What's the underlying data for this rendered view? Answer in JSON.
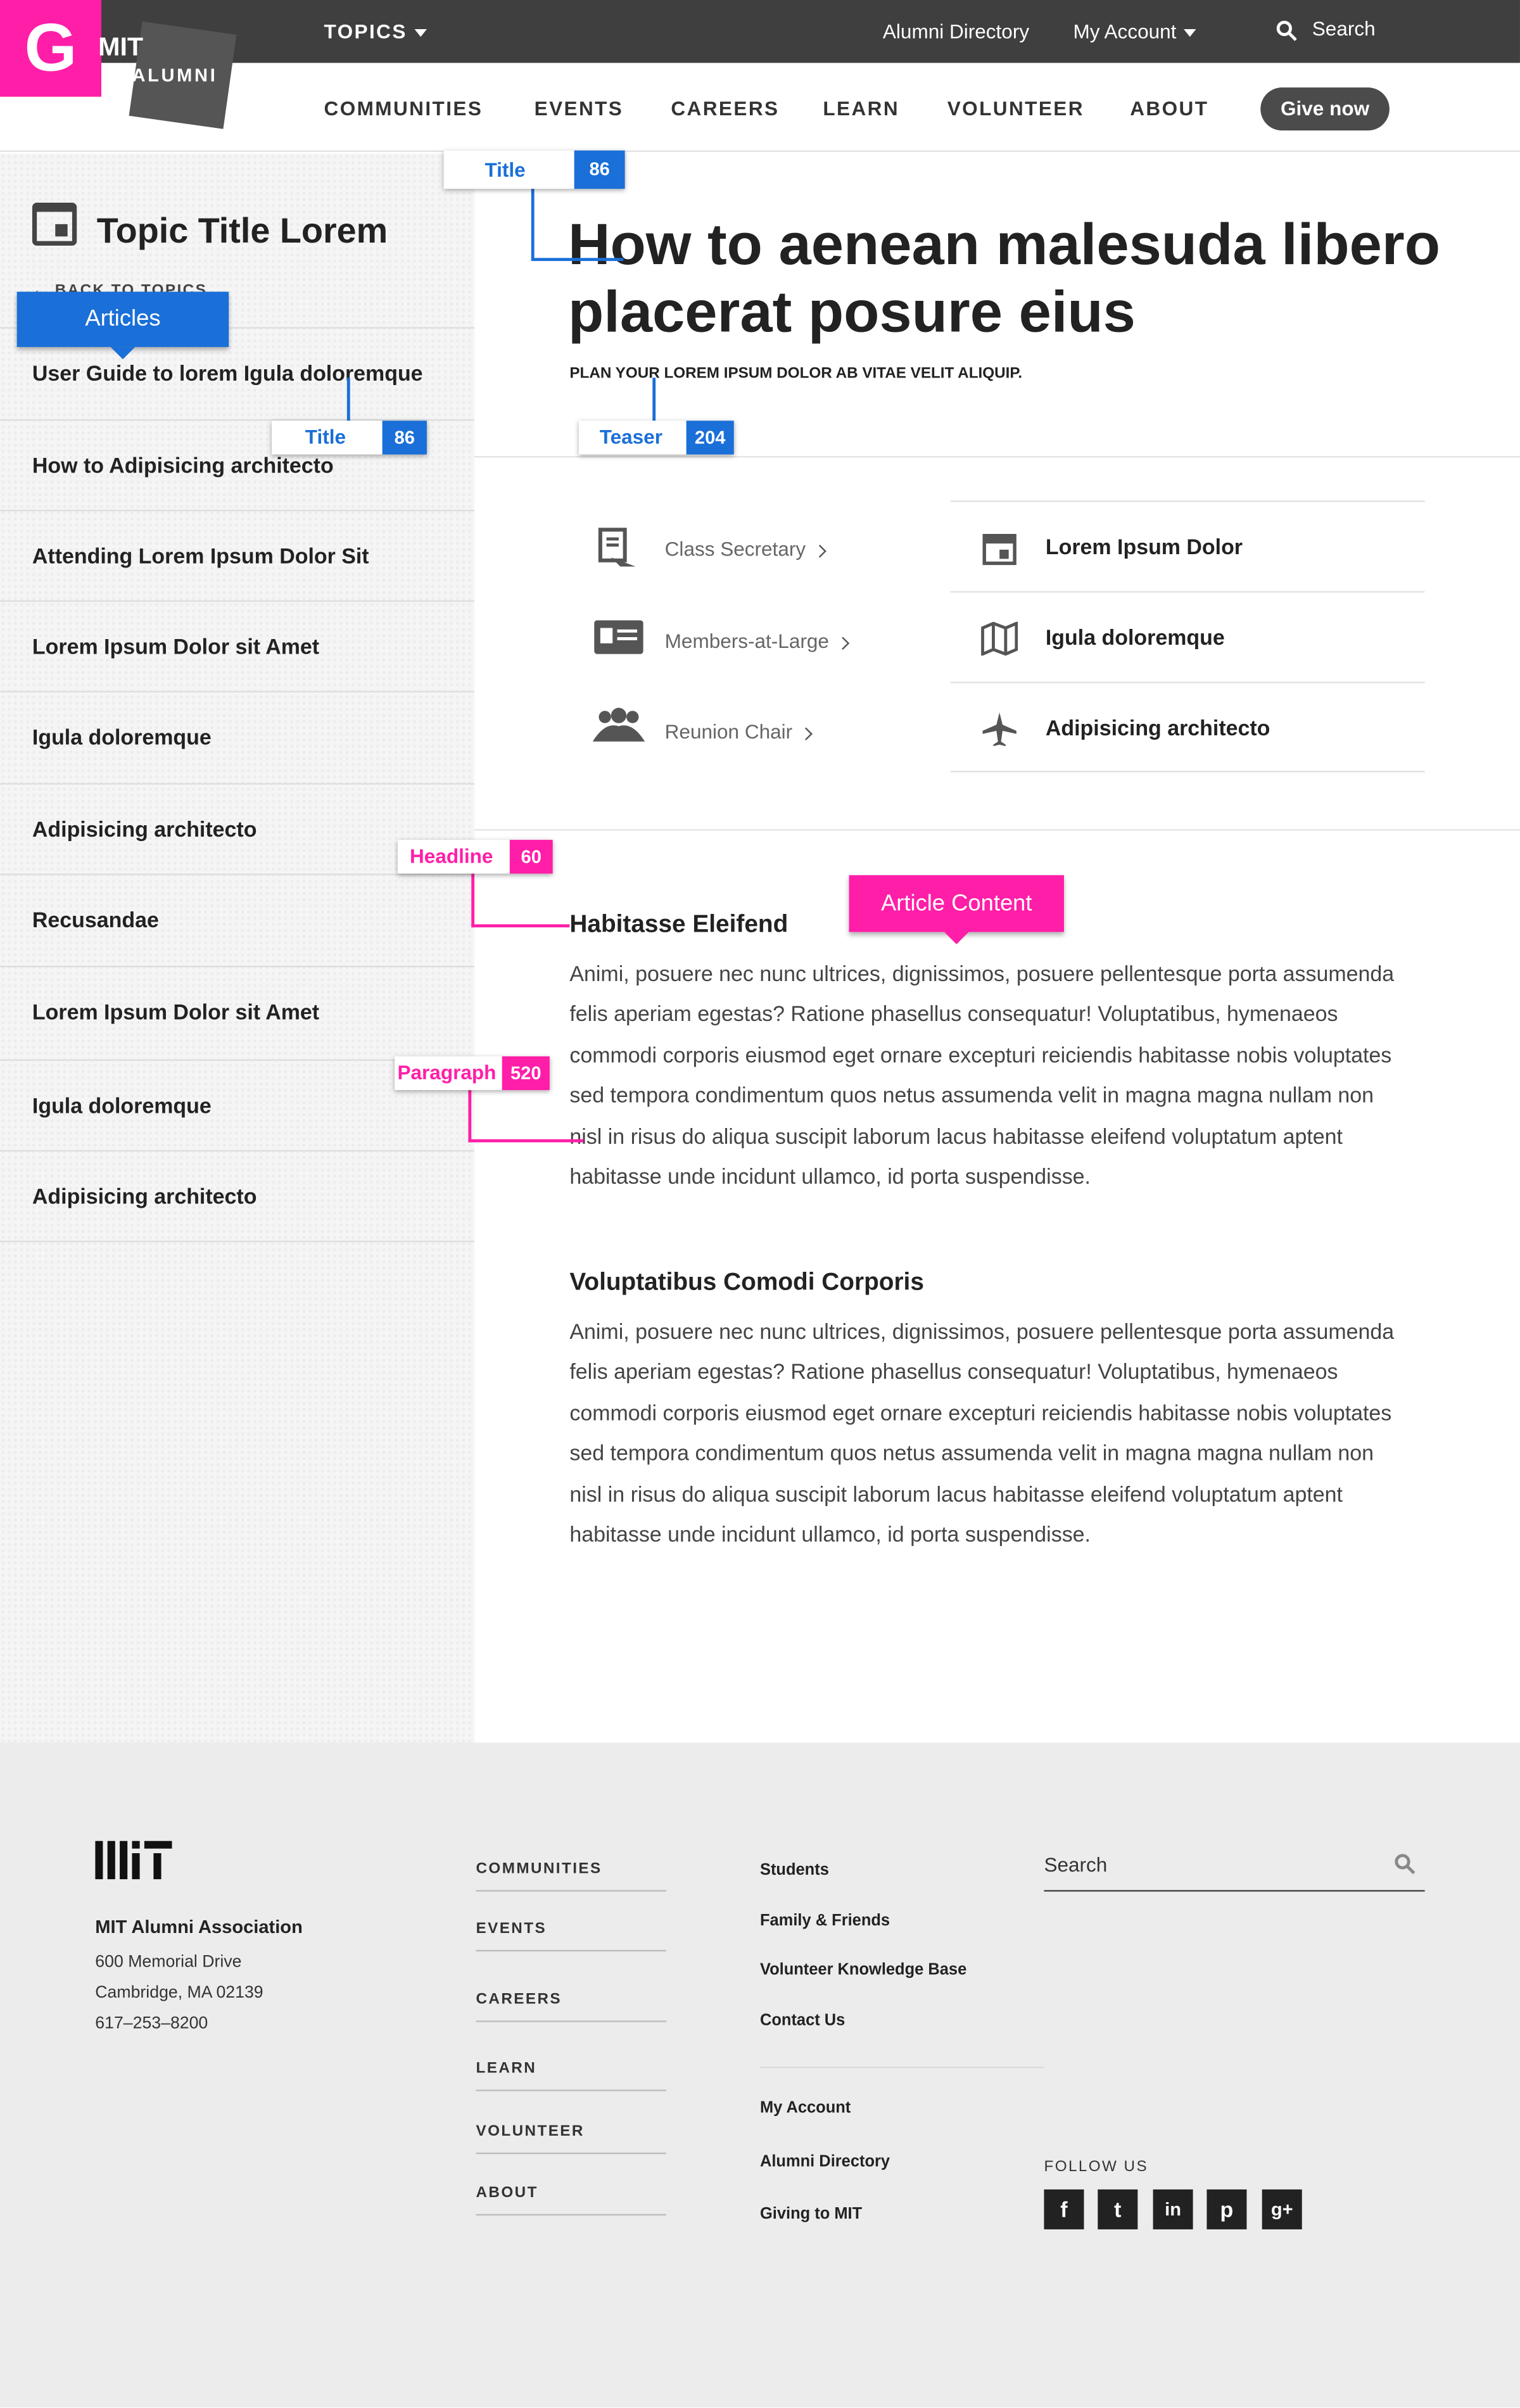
{
  "header": {
    "topics_label": "TOPICS",
    "alumni_directory": "Alumni Directory",
    "my_account": "My Account",
    "search_label": "Search",
    "badge_letter": "G",
    "logo_mit": "MIT",
    "logo_alumni": "ALUMNI",
    "nav": [
      "COMMUNITIES",
      "EVENTS",
      "CAREERS",
      "LEARN",
      "VOLUNTEER",
      "ABOUT"
    ],
    "give_now": "Give now"
  },
  "sidebar": {
    "title": "Topic Title Lorem",
    "back": "BACK TO TOPICS",
    "items": [
      "User Guide to lorem Igula doloremque",
      "How to Adipisicing architecto",
      "Attending Lorem Ipsum Dolor Sit",
      "Lorem Ipsum Dolor sit Amet",
      "Igula doloremque",
      "Adipisicing architecto",
      "Recusandae",
      "Lorem Ipsum Dolor sit Amet",
      "Igula doloremque",
      "Adipisicing architecto"
    ]
  },
  "main": {
    "title": "How to aenean malesuda libero placerat posure eius",
    "teaser": "PLAN YOUR LOREM IPSUM DOLOR AB VITAE VELIT ALIQUIP.",
    "quick_links": [
      "Class Secretary",
      "Members-at-Large",
      "Reunion Chair"
    ],
    "related_links": [
      "Lorem Ipsum Dolor",
      "Igula doloremque",
      "Adipisicing architecto"
    ],
    "sections": [
      {
        "headline": "Habitasse Eleifend",
        "paragraph": "Animi, posuere nec nunc ultrices, dignissimos, posuere pellentesque porta assumenda felis aperiam egestas? Ratione phasellus consequatur! Voluptatibus, hymenaeos commodi corporis eiusmod eget ornare excepturi reiciendis habitasse nobis voluptates sed tempora condimentum quos netus assumenda velit in magna magna nullam non nisl in risus do aliqua suscipit laborum lacus habitasse eleifend voluptatum aptent habitasse unde incidunt ullamco, id porta suspendisse."
      },
      {
        "headline": "Voluptatibus Comodi Corporis",
        "paragraph": "Animi, posuere nec nunc ultrices, dignissimos, posuere pellentesque porta assumenda felis aperiam egestas? Ratione phasellus consequatur! Voluptatibus, hymenaeos commodi corporis eiusmod eget ornare excepturi reiciendis habitasse nobis voluptates sed tempora condimentum quos netus assumenda velit in magna magna nullam non nisl in risus do aliqua suscipit laborum lacus habitasse eleifend voluptatum aptent habitasse unde incidunt ullamco, id porta suspendisse."
      }
    ]
  },
  "annotations": {
    "title_top": {
      "label": "Title",
      "num": "86"
    },
    "title_side": {
      "label": "Title",
      "num": "86"
    },
    "teaser": {
      "label": "Teaser",
      "num": "204"
    },
    "headline": {
      "label": "Headline",
      "num": "60"
    },
    "paragraph": {
      "label": "Paragraph",
      "num": "520"
    },
    "articles_callout": "Articles",
    "content_callout": "Article Content",
    "blue_color": "#1a6fd8",
    "pink_color": "#ff1ea8"
  },
  "footer": {
    "org_name": "MIT Alumni Association",
    "address1": "600 Memorial Drive",
    "address2": "Cambridge, MA 02139",
    "phone": "617–253–8200",
    "nav": [
      "COMMUNITIES",
      "EVENTS",
      "CAREERS",
      "LEARN",
      "VOLUNTEER",
      "ABOUT"
    ],
    "links_a": [
      "Students",
      "Family & Friends",
      "Volunteer Knowledge Base",
      "Contact Us"
    ],
    "links_b": [
      "My Account",
      "Alumni Directory",
      "Giving to MIT"
    ],
    "search_placeholder": "Search",
    "follow_us": "FOLLOW US",
    "social": [
      "f",
      "t",
      "in",
      "p",
      "g+"
    ]
  }
}
